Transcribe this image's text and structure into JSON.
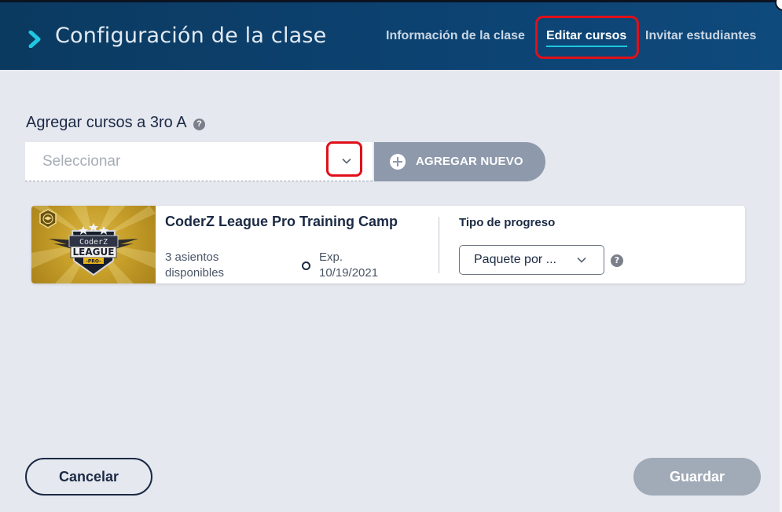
{
  "header": {
    "title": "Configuración de la clase",
    "tabs": [
      {
        "label": "Información de la clase",
        "active": false
      },
      {
        "label": "Editar cursos",
        "active": true
      },
      {
        "label": "Invitar estudiantes",
        "active": false
      }
    ]
  },
  "add_courses": {
    "title": "Agregar cursos a 3ro A",
    "help_icon": "question-icon",
    "select_placeholder": "Seleccionar",
    "add_button_label": "AGREGAR NUEVO"
  },
  "course_card": {
    "title": "CoderZ League Pro Training Camp",
    "seats": "3 asientos disponibles",
    "exp_label": "Exp.",
    "exp_date": "10/19/2021",
    "progress_type_label": "Tipo de progreso",
    "progress_type_value": "Paquete por ...",
    "logo_text": {
      "line1": "CoderZ",
      "line2": "LEAGUE",
      "line3": "-PRO-"
    }
  },
  "footer": {
    "cancel_label": "Cancelar",
    "save_label": "Guardar"
  },
  "colors": {
    "header_bg": "#0c4373",
    "accent": "#1ec8e0",
    "highlight_red": "#e0101a",
    "disabled_button": "#a1aab7"
  }
}
